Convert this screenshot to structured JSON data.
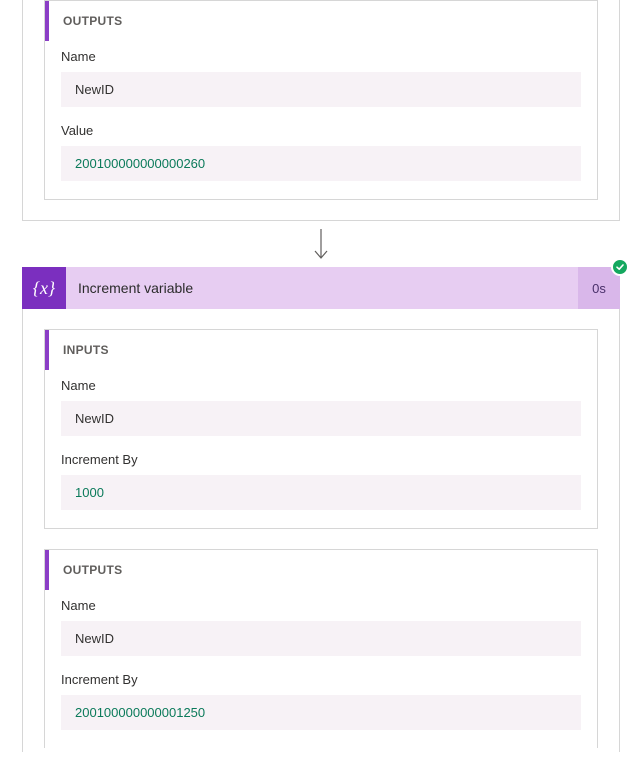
{
  "top_card": {
    "outputs": {
      "header": "OUTPUTS",
      "name_label": "Name",
      "name_value": "NewID",
      "value_label": "Value",
      "value_value": "200100000000000260"
    }
  },
  "action": {
    "icon_text": "{x}",
    "title": "Increment variable",
    "duration": "0s"
  },
  "bottom_card": {
    "inputs": {
      "header": "INPUTS",
      "name_label": "Name",
      "name_value": "NewID",
      "increment_label": "Increment By",
      "increment_value": "1000"
    },
    "outputs": {
      "header": "OUTPUTS",
      "name_label": "Name",
      "name_value": "NewID",
      "increment_label": "Increment By",
      "increment_value": "200100000000001250"
    }
  }
}
